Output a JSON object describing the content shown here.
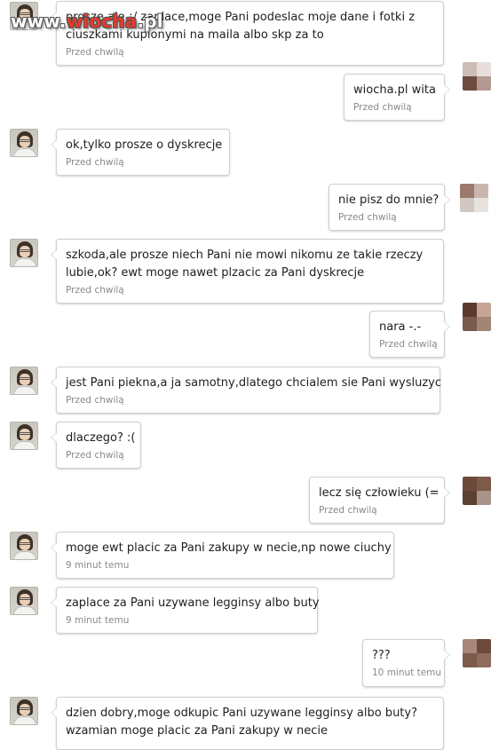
{
  "watermark": {
    "prefix": "www.",
    "brand": "wiocha",
    "suffix": ".pl"
  },
  "messages": [
    {
      "side": "left",
      "text_lines": [
        "prosze ale ¡/ zaplace,moge Pani podeslac moje dane i fotki z",
        "ciuszkami kupionymi na maila albo skp za to"
      ],
      "time": "Przed chwilą"
    },
    {
      "side": "right",
      "text_lines": [
        "wiocha.pl wita"
      ],
      "time": "Przed chwilą"
    },
    {
      "side": "left",
      "text_lines": [
        "ok,tylko prosze o dyskrecje"
      ],
      "time": "Przed chwilą"
    },
    {
      "side": "right",
      "text_lines": [
        "nie pisz do mnie?"
      ],
      "time": "Przed chwilą"
    },
    {
      "side": "left",
      "text_lines": [
        "szkoda,ale prosze niech Pani nie mowi nikomu ze takie rzeczy",
        "lubie,ok? ewt moge nawet plzacic za Pani dyskrecje"
      ],
      "time": "Przed chwilą"
    },
    {
      "side": "right",
      "text_lines": [
        "nara -.-"
      ],
      "time": "Przed chwilą"
    },
    {
      "side": "left",
      "text_lines": [
        "jest Pani piekna,a ja samotny,dlatego chcialem sie Pani wysluzyc"
      ],
      "time": "Przed chwilą"
    },
    {
      "side": "left",
      "text_lines": [
        "dlaczego? :("
      ],
      "time": "Przed chwilą"
    },
    {
      "side": "right",
      "text_lines": [
        "lecz się człowieku (="
      ],
      "time": "Przed chwilą"
    },
    {
      "side": "left",
      "text_lines": [
        "moge ewt placic za Pani zakupy w necie,np nowe ciuchy"
      ],
      "time": "9 minut temu"
    },
    {
      "side": "left",
      "text_lines": [
        "zaplace za Pani uzywane legginsy albo buty"
      ],
      "time": "9 minut temu"
    },
    {
      "side": "right",
      "text_lines": [
        "???"
      ],
      "time": "10 minut temu"
    },
    {
      "side": "left",
      "text_lines": [
        "dzien dobry,moge odkupic Pani uzywane legginsy albo buty?",
        "wzamian moge placic za Pani zakupy w necie"
      ],
      "time": ""
    }
  ],
  "colors": {
    "bubble_border": "#cfcfcf",
    "time_text": "#8a8a8a",
    "watermark_brand": "#e23b2e"
  }
}
